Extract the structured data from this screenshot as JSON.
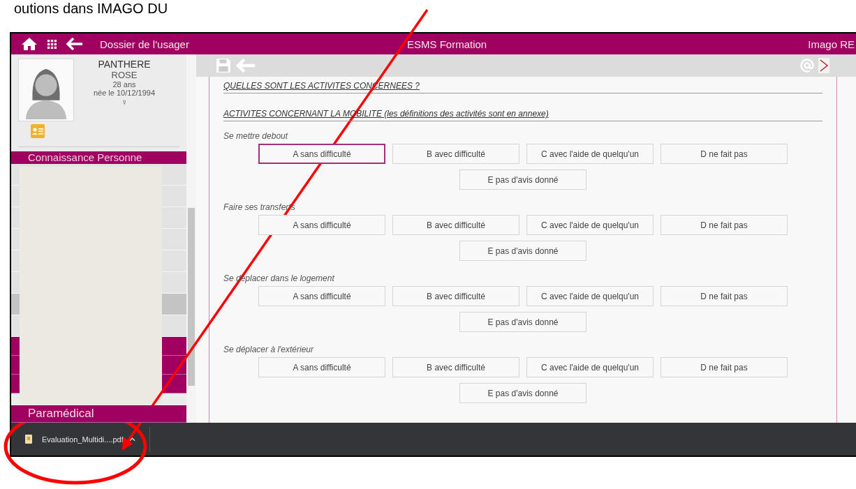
{
  "caption": "outions dans IMAGO DU",
  "app_bar": {
    "title": "Dossier de l'usager",
    "center": "ESMS Formation",
    "right": "Imago RE"
  },
  "patient": {
    "last_name": "PANTHERE",
    "first_name": "ROSE",
    "age": "28 ans",
    "birth": "née le 10/12/1994",
    "sex_symbol": "♀"
  },
  "menu": {
    "section": "Connaissance Personne",
    "items": [
      {
        "label": "Paramédical"
      }
    ]
  },
  "form": {
    "heading": "QUELLES SONT LES ACTIVITES CONCERNEES ?",
    "subheading": "ACTIVITES CONCERNANT LA MOBILITE (les définitions des activités sont en annexe)",
    "questions": [
      {
        "label": "Se mettre debout",
        "options": [
          {
            "label": "A sans difficulté",
            "selected": true
          },
          {
            "label": "B avec difficulté",
            "selected": false
          },
          {
            "label": "C avec l'aide de quelqu'un",
            "selected": false
          },
          {
            "label": "D ne fait pas",
            "selected": false
          },
          {
            "label": "E pas d'avis donné",
            "selected": false
          }
        ]
      },
      {
        "label": "Faire ses transferts",
        "options": [
          {
            "label": "A sans difficulté",
            "selected": false
          },
          {
            "label": "B avec difficulté",
            "selected": false
          },
          {
            "label": "C avec l'aide de quelqu'un",
            "selected": false
          },
          {
            "label": "D ne fait pas",
            "selected": false
          },
          {
            "label": "E pas d'avis donné",
            "selected": false
          }
        ]
      },
      {
        "label": "Se déplacer dans le logement",
        "options": [
          {
            "label": "A sans difficulté",
            "selected": false
          },
          {
            "label": "B avec difficulté",
            "selected": false
          },
          {
            "label": "C avec l'aide de quelqu'un",
            "selected": false
          },
          {
            "label": "D ne fait pas",
            "selected": false
          },
          {
            "label": "E pas d'avis donné",
            "selected": false
          }
        ]
      },
      {
        "label": "Se déplacer à l'extérieur",
        "options": [
          {
            "label": "A sans difficulté",
            "selected": false
          },
          {
            "label": "B avec difficulté",
            "selected": false
          },
          {
            "label": "C avec l'aide de quelqu'un",
            "selected": false
          },
          {
            "label": "D ne fait pas",
            "selected": false
          },
          {
            "label": "E pas d'avis donné",
            "selected": false
          }
        ]
      }
    ]
  },
  "downloads": [
    {
      "filename": "Evaluation_Multidi....pdf"
    }
  ]
}
